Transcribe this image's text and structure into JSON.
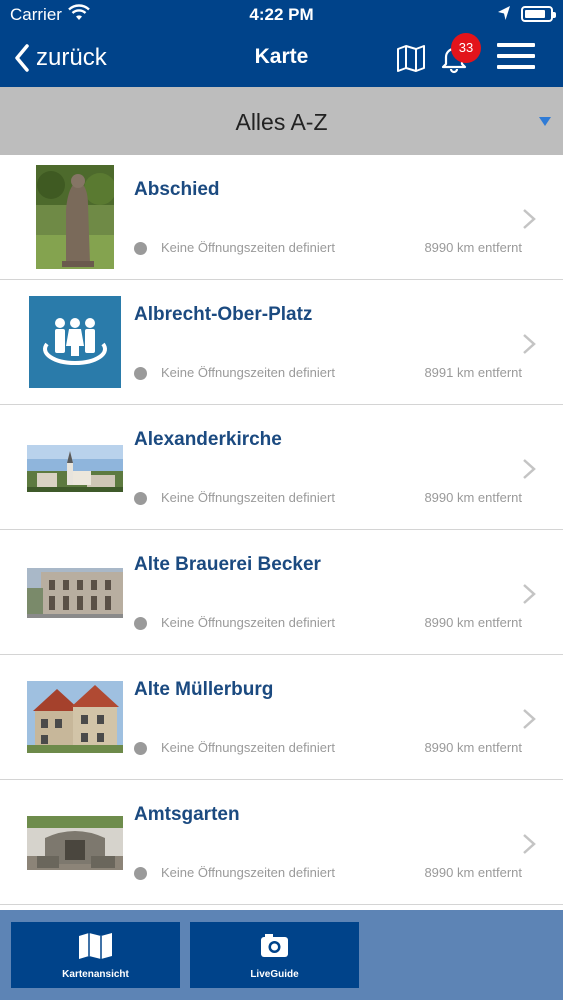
{
  "status_bar": {
    "carrier": "Carrier",
    "time": "4:22 PM",
    "battery_level": 0.85
  },
  "nav": {
    "back_label": "zurück",
    "title": "Karte",
    "notification_count": "33"
  },
  "filter": {
    "label": "Alles A-Z"
  },
  "items": [
    {
      "title": "Abschied",
      "hours": "Keine Öffnungszeiten definiert",
      "distance": "8990 km entfernt",
      "image": "statue-photo"
    },
    {
      "title": "Albrecht-Ober-Platz",
      "hours": "Keine Öffnungszeiten definiert",
      "distance": "8991 km entfernt",
      "image": "people-square-icon"
    },
    {
      "title": "Alexanderkirche",
      "hours": "Keine Öffnungszeiten definiert",
      "distance": "8990 km entfernt",
      "image": "church-photo"
    },
    {
      "title": "Alte Brauerei Becker",
      "hours": "Keine Öffnungszeiten definiert",
      "distance": "8990 km entfernt",
      "image": "brewery-photo"
    },
    {
      "title": "Alte Müllerburg",
      "hours": "Keine Öffnungszeiten definiert",
      "distance": "8990 km entfernt",
      "image": "castle-photo"
    },
    {
      "title": "Amtsgarten",
      "hours": "Keine Öffnungszeiten definiert",
      "distance": "8990 km entfernt",
      "image": "garden-photo"
    }
  ],
  "tabs": [
    {
      "label": "Kartenansicht",
      "icon": "map-icon"
    },
    {
      "label": "LiveGuide",
      "icon": "camera-icon"
    }
  ],
  "colors": {
    "primary": "#00438a",
    "tabbar_bg": "#5d84b5",
    "filter_bg": "#bdbdbd",
    "title_text": "#1b4a80",
    "badge": "#e3141b",
    "caret": "#2f7bd6"
  }
}
